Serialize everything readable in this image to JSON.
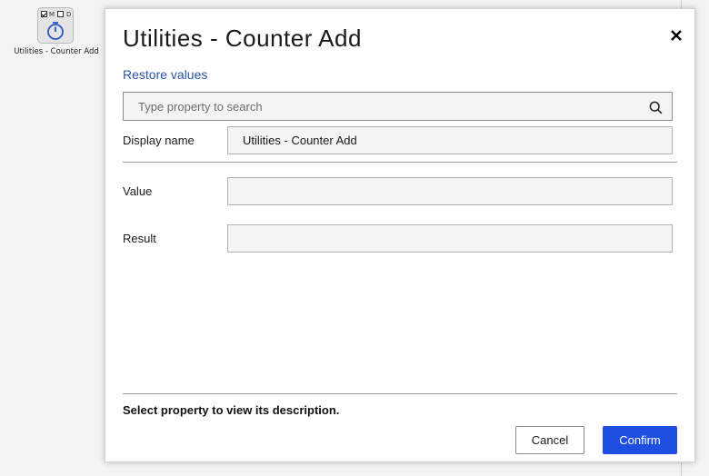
{
  "canvas": {
    "node": {
      "checkbox_m_label": "M",
      "checkbox_m_checked": true,
      "checkbox_d_label": "D",
      "checkbox_d_checked": false,
      "icon": "stopwatch-icon",
      "label": "Utilities - Counter Add"
    }
  },
  "dialog": {
    "title": "Utilities - Counter Add",
    "close_icon": "close-icon",
    "restore_label": "Restore values",
    "search": {
      "placeholder": "Type property to search",
      "value": "",
      "icon": "search-icon"
    },
    "display_name": {
      "label": "Display name",
      "value": "Utilities - Counter Add"
    },
    "properties": [
      {
        "label": "Value",
        "value": ""
      },
      {
        "label": "Result",
        "value": ""
      }
    ],
    "description": "Select property to view its description.",
    "cancel_label": "Cancel",
    "confirm_label": "Confirm"
  },
  "colors": {
    "accent": "#1f4fe0",
    "link": "#2d56a8"
  }
}
